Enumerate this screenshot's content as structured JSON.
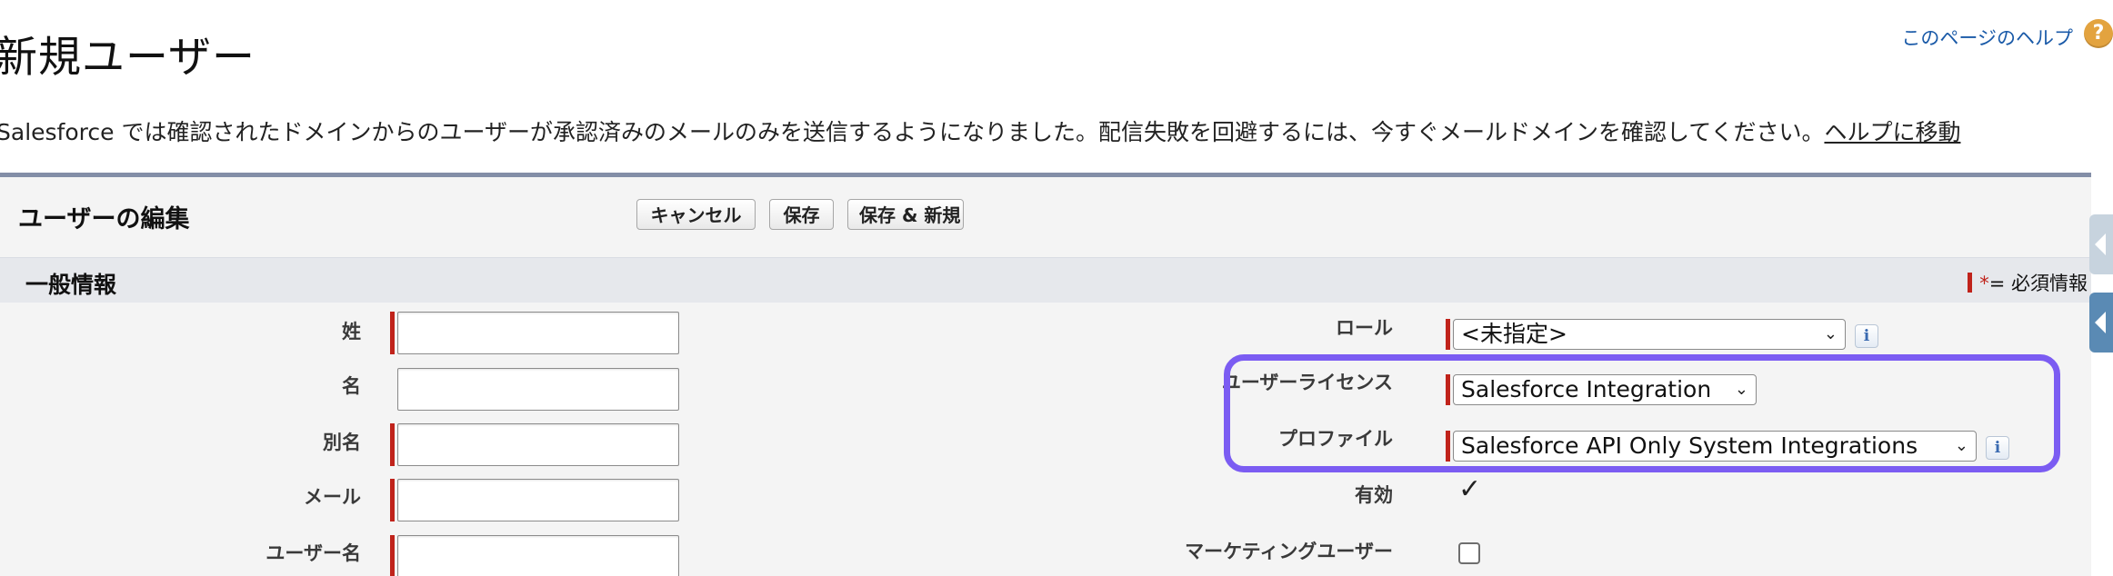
{
  "page": {
    "title": "新規ユーザー",
    "help_link": "このページのヘルプ",
    "help_icon": "?"
  },
  "notice": {
    "text": "Salesforce では確認されたドメインからのユーザーが承認済みのメールのみを送信するようになりました。配信失敗を回避するには、今すぐメールドメインを確認してください。",
    "link": "ヘルプに移動"
  },
  "edit_block": {
    "title": "ユーザーの編集",
    "buttons": {
      "cancel": "キャンセル",
      "save": "保存",
      "save_new": "保存 & 新規"
    }
  },
  "section": {
    "title": "一般情報",
    "required_legend": {
      "star": "*",
      "text": "= 必須情報"
    }
  },
  "fields_left": {
    "last_name": {
      "label": "姓",
      "value": ""
    },
    "first_name": {
      "label": "名",
      "value": ""
    },
    "alias": {
      "label": "別名",
      "value": ""
    },
    "email": {
      "label": "メール",
      "value": ""
    },
    "username": {
      "label": "ユーザー名",
      "value": ""
    }
  },
  "fields_right": {
    "role": {
      "label": "ロール",
      "value": "<未指定>",
      "info": "i"
    },
    "user_license": {
      "label": "ユーザーライセンス",
      "value": "Salesforce Integration"
    },
    "profile": {
      "label": "プロファイル",
      "value": "Salesforce API Only System Integrations",
      "info": "i"
    },
    "active": {
      "label": "有効",
      "checked": true,
      "mark": "✓"
    },
    "marketing_user": {
      "label": "マーケティングユーザー",
      "checked": false
    }
  },
  "icons": {
    "help": "help-icon",
    "info": "info-icon",
    "chevron": "chevron-down-icon",
    "side_tab": "collapse-arrow-icon"
  },
  "colors": {
    "required": "#c0231b",
    "highlight": "#7b5cf2",
    "block_border": "#838ea7",
    "link": "#1a5aa8"
  }
}
